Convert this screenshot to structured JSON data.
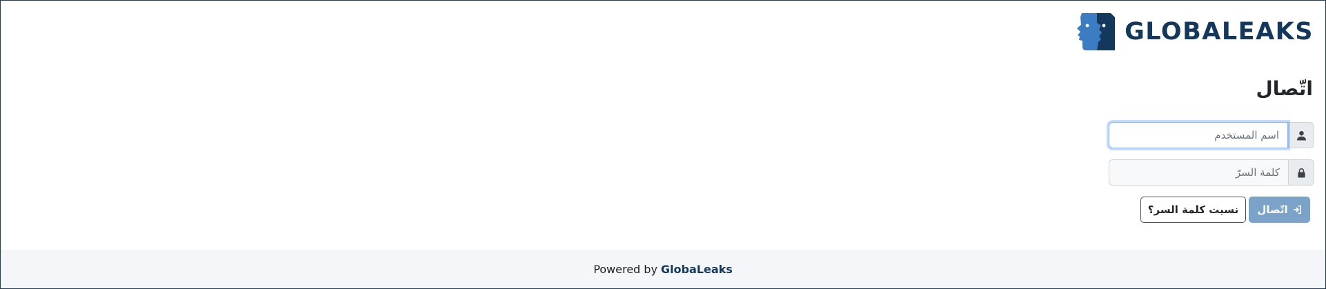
{
  "header": {
    "logo_text": "GLOBALEAKS",
    "logo_icon": "two-faces-logo"
  },
  "login": {
    "title": "اتّصال",
    "username_placeholder": "اسم المستخدم",
    "username_value": "",
    "password_placeholder": "كلمة السرّ",
    "password_value": "",
    "username_icon": "user-icon",
    "password_icon": "lock-icon",
    "login_button_label": "اتّصال",
    "login_button_icon": "sign-in-icon",
    "forgot_button_label": "نسيت كلمة السر؟"
  },
  "footer": {
    "powered_by": "Powered by",
    "brand_link": "GlobaLeaks"
  },
  "colors": {
    "brand_dark": "#14375c",
    "brand_light": "#3c7cc2",
    "login_button": "#7ba3c9",
    "footer_bg": "#f4f6f9"
  }
}
